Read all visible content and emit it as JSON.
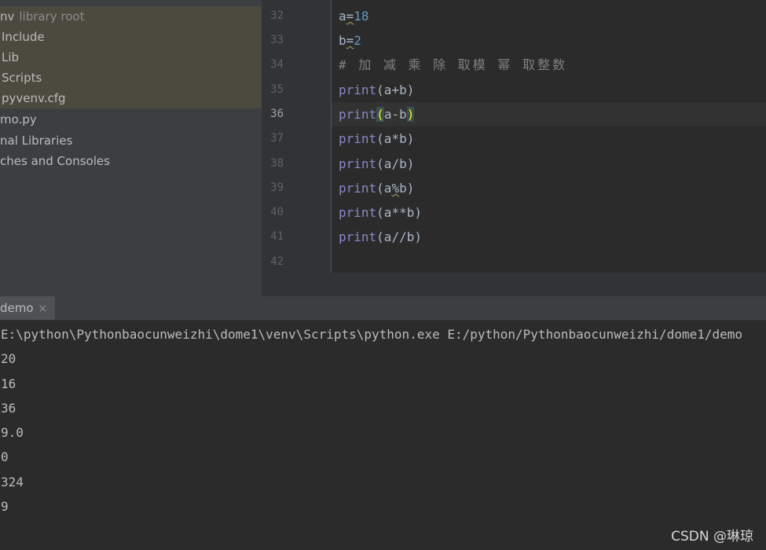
{
  "project_tree": {
    "items": [
      {
        "label": "nv",
        "suffix": "library root"
      },
      {
        "label": "Include"
      },
      {
        "label": "Lib"
      },
      {
        "label": "Scripts"
      },
      {
        "label": "pyvenv.cfg"
      },
      {
        "label": "mo.py"
      },
      {
        "label": "nal Libraries"
      },
      {
        "label": "ches and Consoles"
      }
    ]
  },
  "editor": {
    "line_numbers": [
      "32",
      "33",
      "34",
      "35",
      "36",
      "37",
      "38",
      "39",
      "40",
      "41",
      "42"
    ],
    "lines": {
      "l32": {
        "var": "a",
        "op": "=",
        "num": "18"
      },
      "l33": {
        "var": "b",
        "op": "=",
        "num": "2"
      },
      "l34": {
        "comment": "# 加 减 乘 除 取模 幂 取整数"
      },
      "l35": {
        "fn": "print",
        "args": "(a+b)"
      },
      "l36": {
        "fn": "print",
        "open": "(",
        "inner": "a-b",
        "close": ")"
      },
      "l37": {
        "fn": "print",
        "args": "(a*b)"
      },
      "l38": {
        "fn": "print",
        "args": "(a/b)"
      },
      "l39": {
        "fn": "print",
        "args_a": "(a",
        "args_pct": "%",
        "args_b": "b)"
      },
      "l40": {
        "fn": "print",
        "args": "(a**b)"
      },
      "l41": {
        "fn": "print",
        "args": "(a//b)"
      }
    }
  },
  "run": {
    "tab_label": "demo",
    "close_glyph": "×",
    "command": "E:\\python\\Pythonbaocunweizhi\\dome1\\venv\\Scripts\\python.exe E:/python/Pythonbaocunweizhi/dome1/demo",
    "output": [
      "20",
      "16",
      "36",
      "9.0",
      "0",
      "324",
      "9"
    ]
  },
  "watermark": "CSDN @琳琼",
  "colors": {
    "keyword": "#8888c6",
    "number": "#6897bb",
    "comment": "#808080",
    "brace_match": "#ffef28"
  }
}
